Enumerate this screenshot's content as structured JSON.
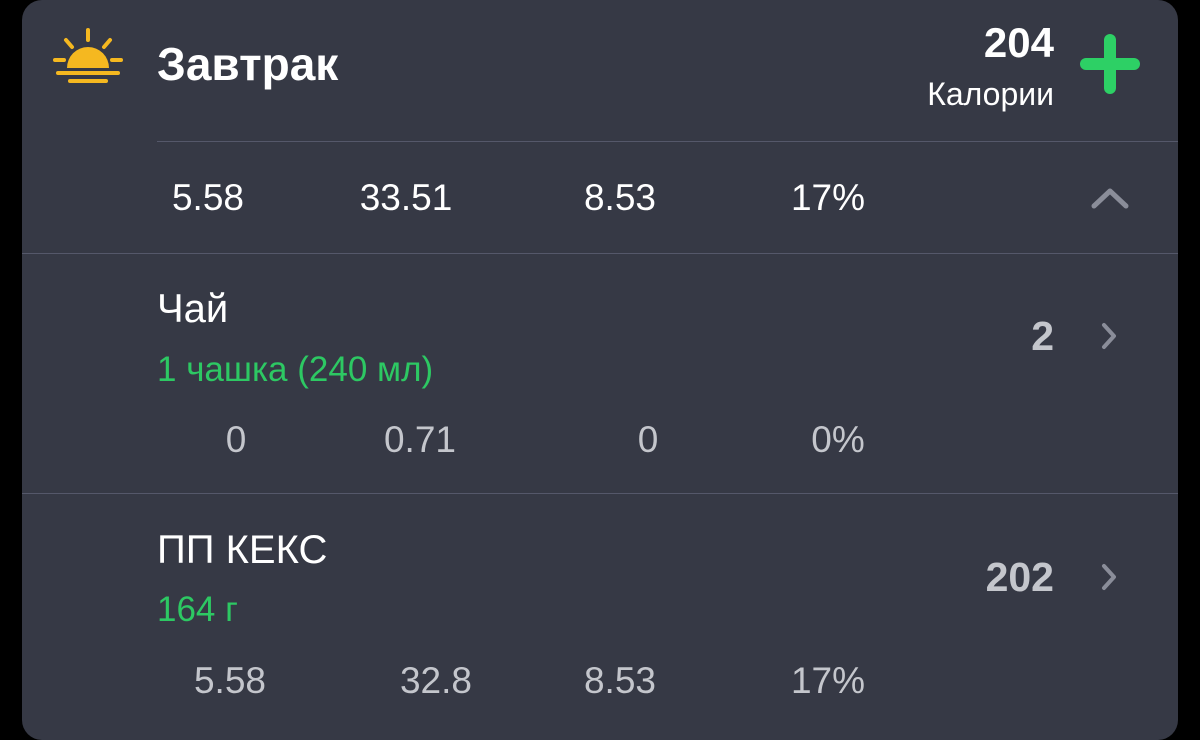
{
  "meal": {
    "title": "Завтрак",
    "calories": "204",
    "calories_label": "Калории",
    "icon": "sunrise-icon",
    "totals": [
      "5.58",
      "33.51",
      "8.53",
      "17%"
    ]
  },
  "colors": {
    "card_bg": "#363945",
    "accent_green": "#2dd065",
    "portion_green": "#2dc863",
    "muted_text": "#c4c6cc",
    "sun_yellow": "#f5b820"
  },
  "items": [
    {
      "name": "Чай",
      "portion": "1 чашка (240 мл)",
      "calories": "2",
      "macros": [
        "0",
        "0.71",
        "0",
        "0%"
      ]
    },
    {
      "name": "ПП КЕКС",
      "portion": "164 г",
      "calories": "202",
      "macros": [
        "5.58",
        "32.8",
        "8.53",
        "17%"
      ]
    }
  ]
}
